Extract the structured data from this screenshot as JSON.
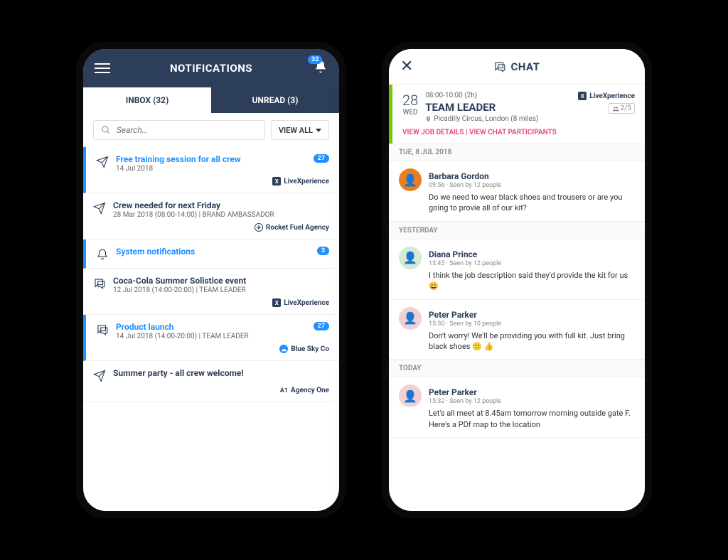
{
  "left": {
    "header_title": "NOTIFICATIONS",
    "bell_badge": "32",
    "tabs": {
      "inbox": "INBOX (32)",
      "unread": "UNREAD (3)"
    },
    "search_placeholder": "Search…",
    "view_all": "VIEW ALL",
    "items": [
      {
        "title": "Free training session for all crew",
        "sub": "14 Jul 2018",
        "badge": "27",
        "agency": "LiveXperience",
        "agency_icon": "X",
        "unread": true,
        "icon": "plane"
      },
      {
        "title": "Crew needed for next Friday",
        "sub": "28 Mar 2018 (08:00-14:00) | BRAND AMBASSADOR",
        "agency": "Rocket Fuel Agency",
        "agency_icon": "✈",
        "agency_style": "ring",
        "unread": false,
        "icon": "plane"
      },
      {
        "title": "System notifications",
        "sub": "",
        "badge": "3",
        "agency": "",
        "unread": true,
        "icon": "bell"
      },
      {
        "title": "Coca-Cola Summer Solistice event",
        "sub": "12 Jul 2018 (14:00-20:00) | TEAM LEADER",
        "agency": "LiveXperience",
        "agency_icon": "X",
        "unread": false,
        "icon": "chat"
      },
      {
        "title": "Product launch",
        "sub": "14 Jul 2018 (14:00-20:00) | TEAM LEADER",
        "badge": "27",
        "agency": "Blue Sky Co",
        "agency_icon": "☁",
        "agency_style": "circle",
        "unread": true,
        "icon": "chat"
      },
      {
        "title": "Summer party - all crew welcome!",
        "sub": "",
        "agency": "Agency One",
        "agency_icon": "A1",
        "agency_style": "plain",
        "unread": false,
        "icon": "plane"
      }
    ]
  },
  "right": {
    "header_title": "CHAT",
    "job": {
      "day": "28",
      "dow": "WED",
      "time": "08:00-10:00 (2h)",
      "role": "TEAM LEADER",
      "location": "Picadilly Circus, London (8 miles)",
      "agency": "LiveXperience",
      "count": "2/5",
      "link_details": "VIEW JOB DETAILS",
      "link_sep": " | ",
      "link_participants": "VIEW CHAT PARTICIPANTS"
    },
    "groups": [
      {
        "label": "TUE, 8 JUL 2018",
        "messages": [
          {
            "name": "Barbara Gordon",
            "meta": "09:56 · Seen by 12 people",
            "text": "Do we need to wear black shoes and trousers or are you going to provie all of our kit?",
            "avatar_bg": "#e67e22"
          }
        ]
      },
      {
        "label": "YESTERDAY",
        "messages": [
          {
            "name": "Diana Prince",
            "meta": "13:45 · Seen by 12 people",
            "text": "I think the job description said they'd provide the kit for us 😀",
            "avatar_bg": "#d4e8d4"
          },
          {
            "name": "Peter Parker",
            "meta": "15:30 · Seen by 10 people",
            "text": "Don't worry! We'll be providing you with full kit. Just bring black shoes 🙂 👍",
            "avatar_bg": "#f0d0d0"
          }
        ]
      },
      {
        "label": "TODAY",
        "messages": [
          {
            "name": "Peter Parker",
            "meta": "15:32 · Seen by 12 people",
            "text": "Let's all meet at 8.45am tomorrow morning outside gate F. Here's a PDf map to the location",
            "avatar_bg": "#f0d0d0"
          }
        ]
      }
    ]
  }
}
